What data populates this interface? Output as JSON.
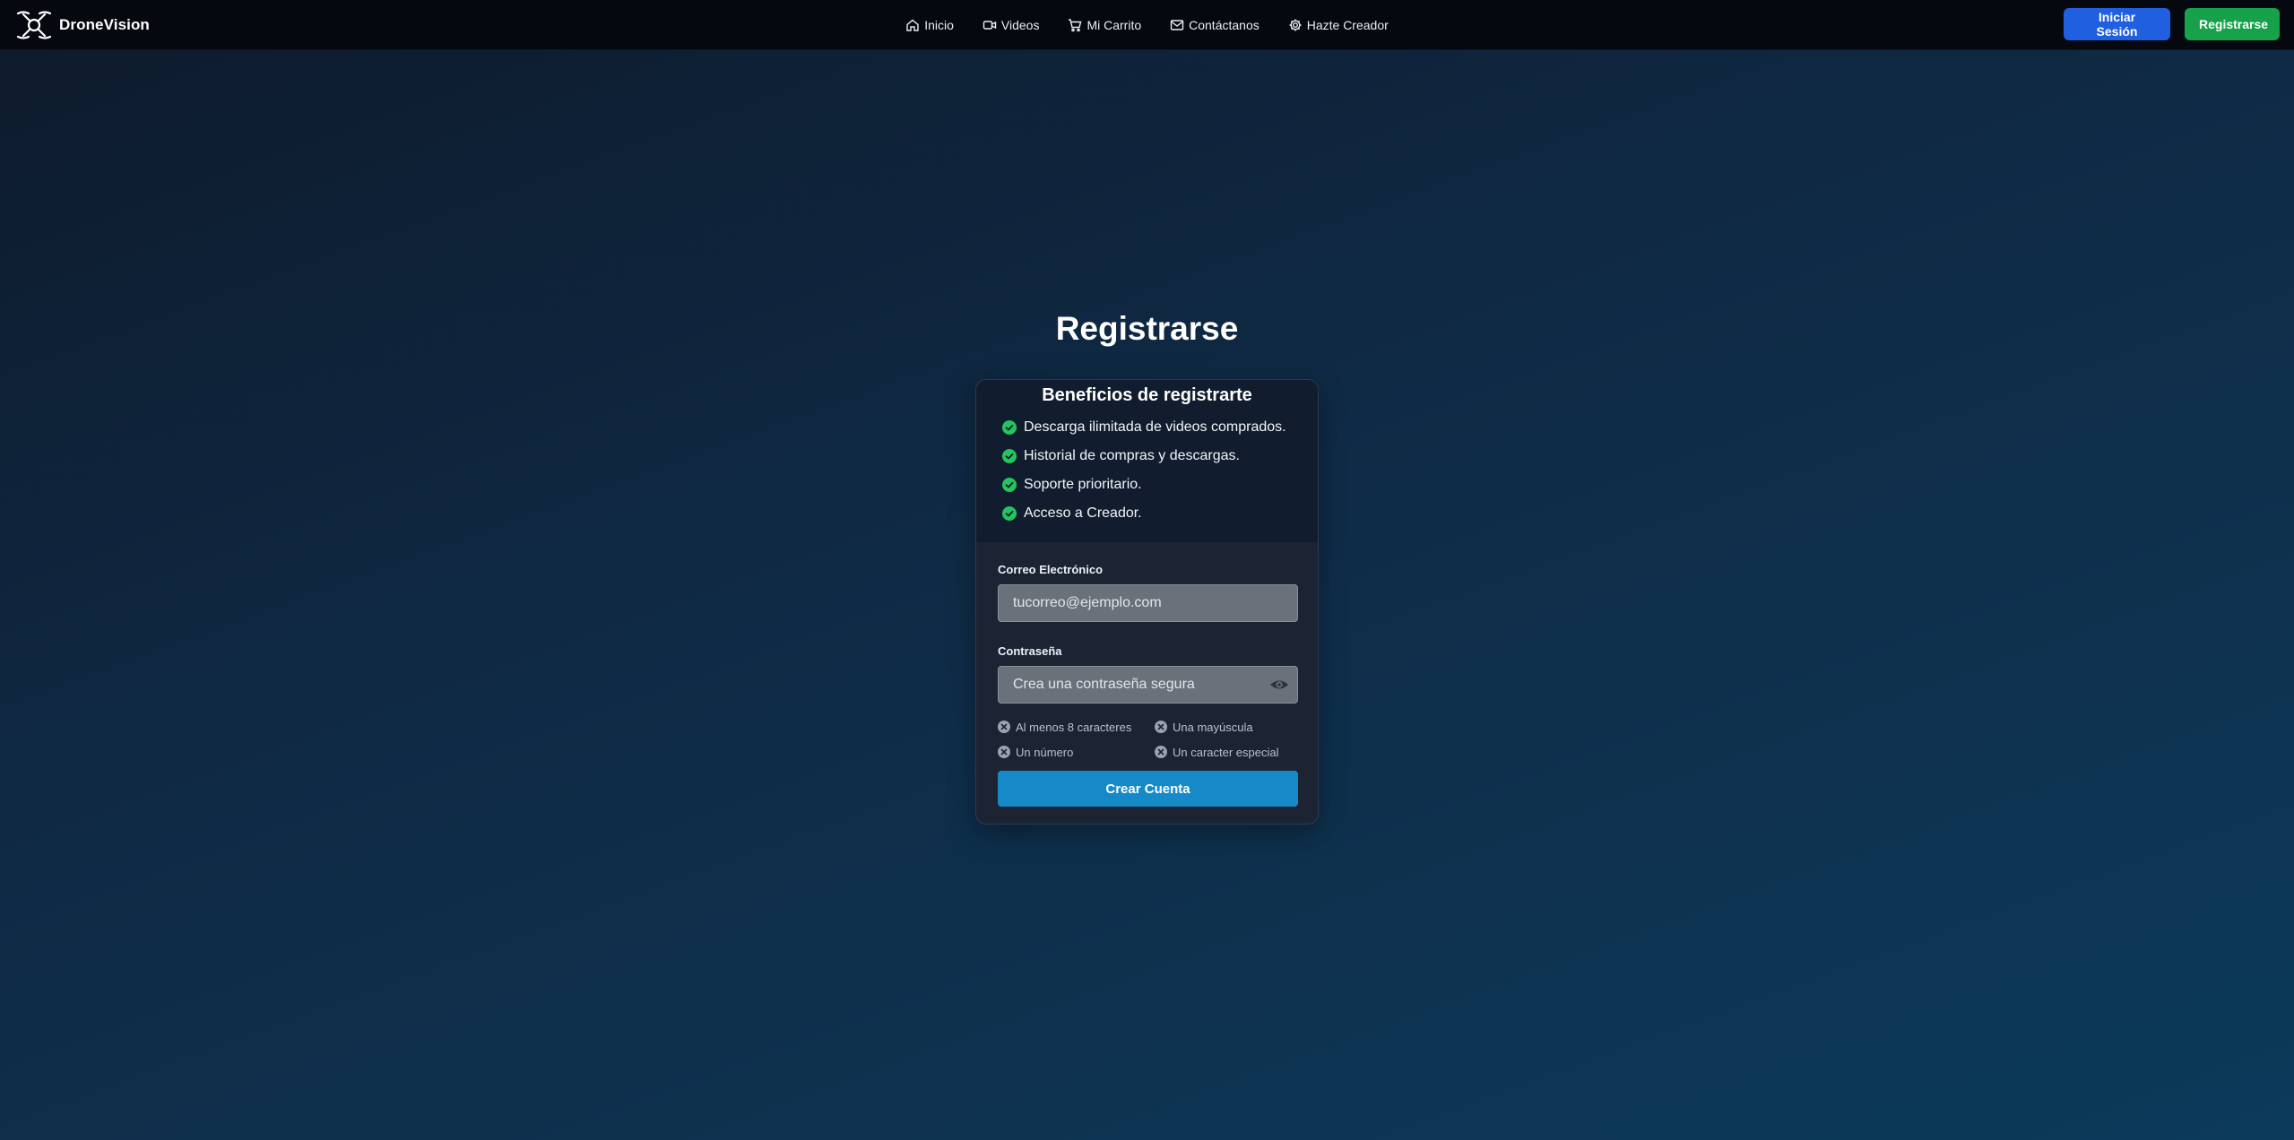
{
  "brand": {
    "name": "DroneVision",
    "icon": "drone-logo-icon"
  },
  "nav": {
    "links": [
      {
        "label": "Inicio",
        "icon": "home-icon"
      },
      {
        "label": "Videos",
        "icon": "video-icon"
      },
      {
        "label": "Mi Carrito",
        "icon": "cart-icon"
      },
      {
        "label": "Contáctanos",
        "icon": "mail-icon"
      },
      {
        "label": "Hazte Creador",
        "icon": "gear-icon"
      }
    ],
    "login_label": "Iniciar Sesión",
    "register_label": "Registrarse"
  },
  "page": {
    "title": "Registrarse"
  },
  "benefits": {
    "title": "Beneficios de registrarte",
    "items": [
      "Descarga ilimitada de videos comprados.",
      "Historial de compras y descargas.",
      "Soporte prioritario.",
      "Acceso a Creador."
    ]
  },
  "form": {
    "email_label": "Correo Electrónico",
    "email_placeholder": "tucorreo@ejemplo.com",
    "email_value": "",
    "password_label": "Contraseña",
    "password_placeholder": "Crea una contraseña segura",
    "password_value": "",
    "rules": [
      "Al menos 8 caracteres",
      "Una mayúscula",
      "Un número",
      "Un caracter especial"
    ],
    "submit_label": "Crear Cuenta"
  },
  "colors": {
    "navbar": "#05090f",
    "login_button": "#1f5fe0",
    "register_button": "#17a14a",
    "submit_button": "#168ac9",
    "check": "#22c55e"
  }
}
